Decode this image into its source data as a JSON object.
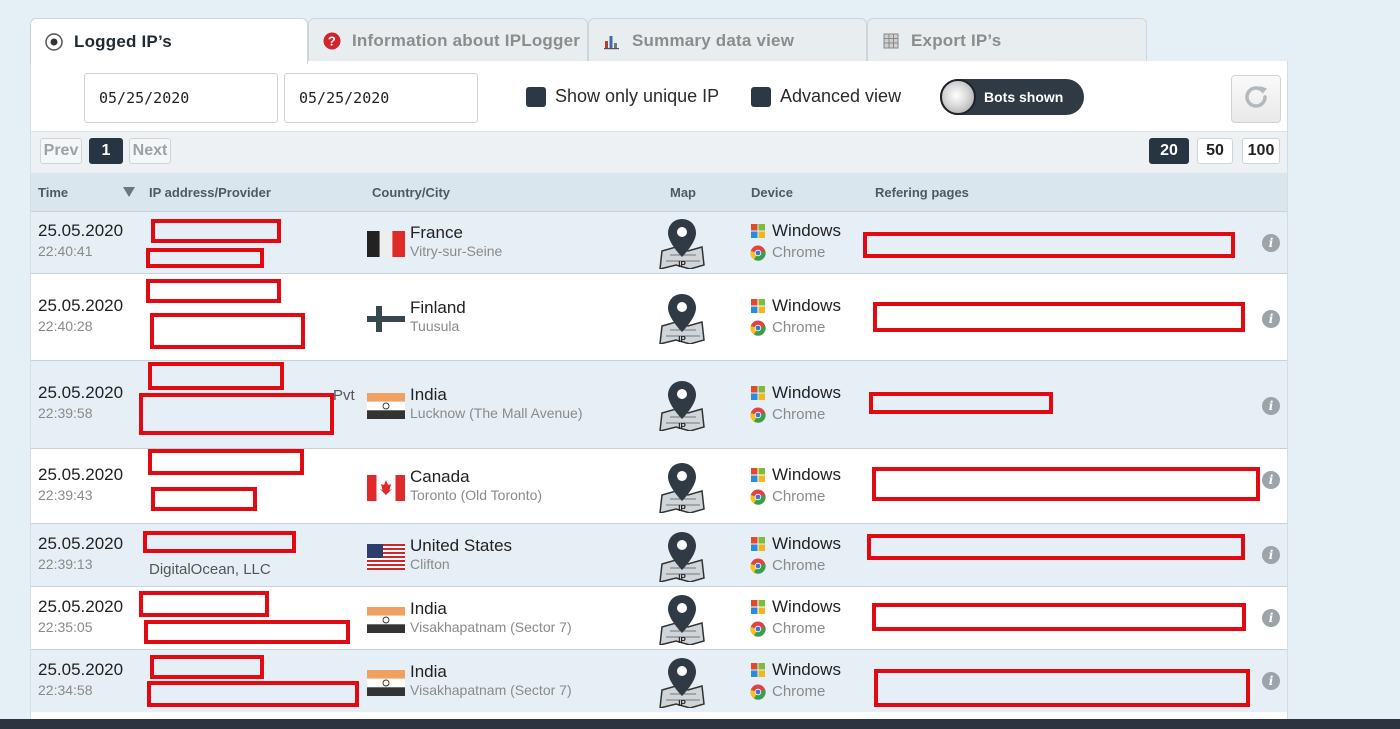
{
  "tabs": [
    {
      "label": "Logged IP’s",
      "icon": "eye-icon",
      "active": true
    },
    {
      "label": "Information about IPLogger",
      "icon": "question-icon",
      "active": false
    },
    {
      "label": "Summary data view",
      "icon": "bar-chart-icon",
      "active": false
    },
    {
      "label": "Export IP’s",
      "icon": "spreadsheet-icon",
      "active": false
    }
  ],
  "filters": {
    "date_from": "05/25/2020",
    "date_to": "05/25/2020",
    "unique_ip_label": "Show only unique IP",
    "advanced_view_label": "Advanced view",
    "bots_toggle_label": "Bots shown"
  },
  "pager": {
    "prev": "Prev",
    "page": "1",
    "next": "Next",
    "sizes": [
      "20",
      "50",
      "100"
    ],
    "active_size": "20"
  },
  "columns": {
    "time": "Time",
    "ip": "IP address/Provider",
    "country": "Country/City",
    "map": "Map",
    "device": "Device",
    "referer": "Refering pages"
  },
  "rows": [
    {
      "date": "25.05.2020",
      "time": "22:40:41",
      "provider": "",
      "country": "France",
      "city": "Vitry-sur-Seine",
      "flag": "france",
      "os": "Windows",
      "browser": "Chrome"
    },
    {
      "date": "25.05.2020",
      "time": "22:40:28",
      "provider": "",
      "country": "Finland",
      "city": "Tuusula",
      "flag": "finland",
      "os": "Windows",
      "browser": "Chrome"
    },
    {
      "date": "25.05.2020",
      "time": "22:39:58",
      "provider": "Pvt",
      "country": "India",
      "city": "Lucknow (The Mall Avenue)",
      "flag": "india",
      "os": "Windows",
      "browser": "Chrome"
    },
    {
      "date": "25.05.2020",
      "time": "22:39:43",
      "provider": "",
      "country": "Canada",
      "city": "Toronto (Old Toronto)",
      "flag": "canada",
      "os": "Windows",
      "browser": "Chrome"
    },
    {
      "date": "25.05.2020",
      "time": "22:39:13",
      "provider": "DigitalOcean, LLC",
      "country": "United States",
      "city": "Clifton",
      "flag": "usa",
      "os": "Windows",
      "browser": "Chrome"
    },
    {
      "date": "25.05.2020",
      "time": "22:35:05",
      "provider": "",
      "country": "India",
      "city": "Visakhapatnam (Sector 7)",
      "flag": "india",
      "os": "Windows",
      "browser": "Chrome"
    },
    {
      "date": "25.05.2020",
      "time": "22:34:58",
      "provider": "",
      "country": "India",
      "city": "Visakhapatnam (Sector 7)",
      "flag": "india",
      "os": "Windows",
      "browser": "Chrome"
    }
  ],
  "colors": {
    "accent_dark": "#273441",
    "redaction": "#e20a12",
    "row_alt": "#e6eff5"
  }
}
